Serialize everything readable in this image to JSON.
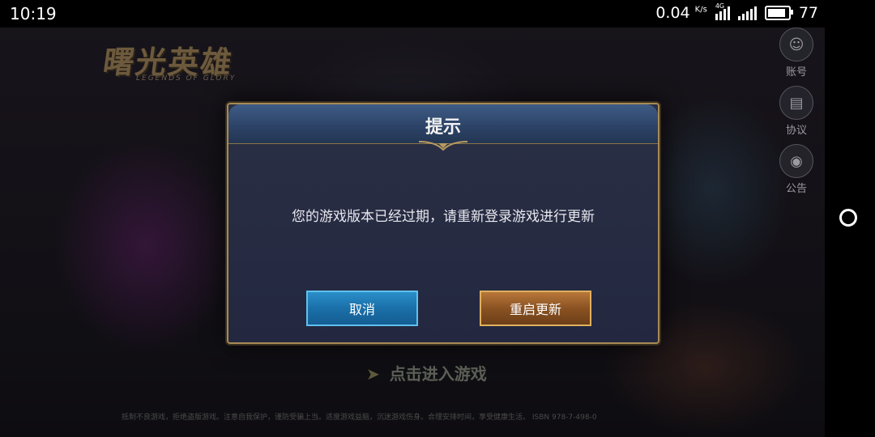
{
  "status_bar": {
    "time": "10:19",
    "net_speed": "0.04",
    "net_speed_unit": "K/s",
    "network_type": "4G",
    "battery_level": "77"
  },
  "game": {
    "logo_text": "曙光英雄",
    "logo_subtitle": "LEGENDS OF GLORY",
    "side_buttons": [
      {
        "label": "账号",
        "icon": "account-icon"
      },
      {
        "label": "协议",
        "icon": "agreement-icon"
      },
      {
        "label": "公告",
        "icon": "announcement-icon"
      }
    ],
    "enter_game_label": "点击进入游戏",
    "footer_notice": "抵制不良游戏，拒绝盗版游戏。注意自我保护，谨防受骗上当。适度游戏益脑，沉迷游戏伤身。合理安排时间，享受健康生活。 ISBN 978-7-498-0"
  },
  "dialog": {
    "title": "提示",
    "message": "您的游戏版本已经过期，请重新登录游戏进行更新",
    "cancel_label": "取消",
    "restart_label": "重启更新"
  },
  "colors": {
    "dialog_border": "#a88a54",
    "cancel_button": "#1a6fa8",
    "restart_button": "#8a5222"
  }
}
